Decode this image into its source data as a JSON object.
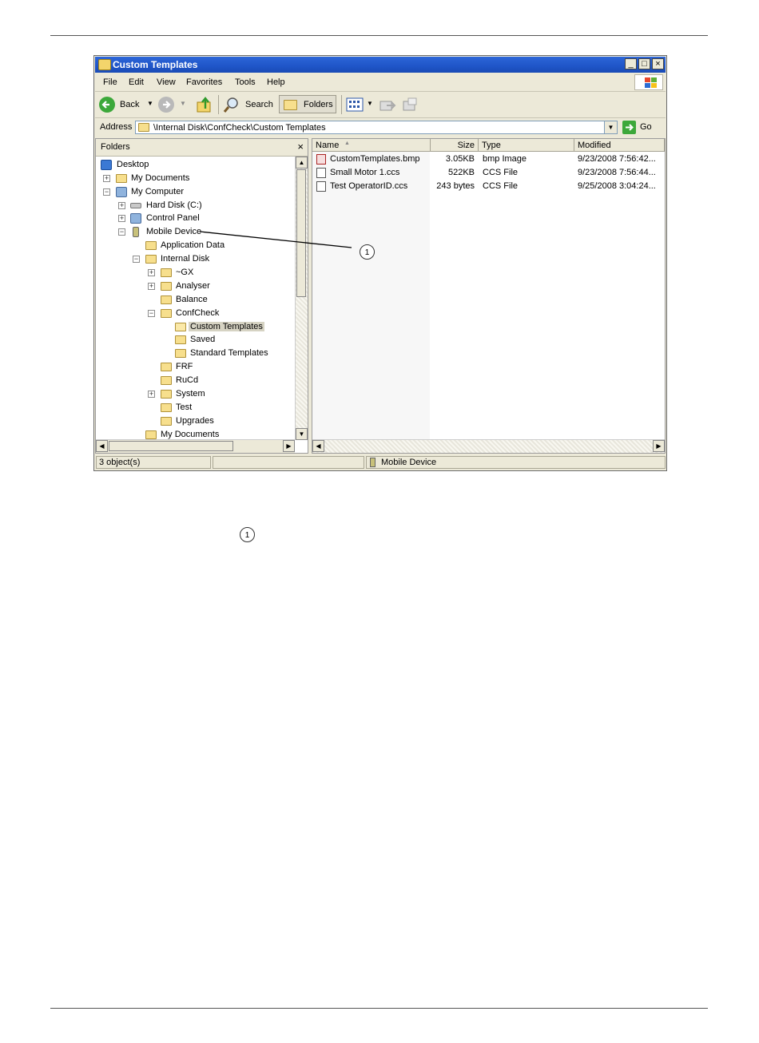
{
  "window": {
    "title": "Custom Templates",
    "minimize": "_",
    "maximize": "□",
    "close": "×"
  },
  "menu": [
    "File",
    "Edit",
    "View",
    "Favorites",
    "Tools",
    "Help"
  ],
  "toolbar": {
    "back_label": "Back",
    "search_label": "Search",
    "folders_label": "Folders"
  },
  "address": {
    "label": "Address",
    "value": "\\Internal Disk\\ConfCheck\\Custom Templates",
    "go_label": "Go"
  },
  "folders_pane": {
    "title": "Folders",
    "close": "×",
    "tree": [
      {
        "label": "Desktop",
        "expander": ""
      },
      {
        "label": "My Documents",
        "expander": "+"
      },
      {
        "label": "My Computer",
        "expander": "−"
      },
      {
        "label": "Hard Disk (C:)",
        "expander": "+"
      },
      {
        "label": "Control Panel",
        "expander": "+"
      },
      {
        "label": "Mobile Device",
        "expander": "−"
      },
      {
        "label": "Application Data",
        "expander": ""
      },
      {
        "label": "Internal Disk",
        "expander": "−"
      },
      {
        "label": "~GX",
        "expander": "+"
      },
      {
        "label": "Analyser",
        "expander": "+"
      },
      {
        "label": "Balance",
        "expander": ""
      },
      {
        "label": "ConfCheck",
        "expander": "−"
      },
      {
        "label": "Custom Templates",
        "expander": ""
      },
      {
        "label": "Saved",
        "expander": ""
      },
      {
        "label": "Standard Templates",
        "expander": ""
      },
      {
        "label": "FRF",
        "expander": ""
      },
      {
        "label": "RuCd",
        "expander": ""
      },
      {
        "label": "System",
        "expander": "+"
      },
      {
        "label": "Test",
        "expander": ""
      },
      {
        "label": "Upgrades",
        "expander": ""
      },
      {
        "label": "My Documents",
        "expander": ""
      }
    ]
  },
  "files": {
    "columns": [
      "Name",
      "Size",
      "Type",
      "Modified"
    ],
    "sort_indicator": "▲",
    "rows": [
      {
        "name": "CustomTemplates.bmp",
        "size": "3.05KB",
        "type": "bmp Image",
        "modified": "9/23/2008  7:56:42..."
      },
      {
        "name": "Small Motor 1.ccs",
        "size": "522KB",
        "type": "CCS File",
        "modified": "9/23/2008  7:56:44..."
      },
      {
        "name": "Test OperatorID.ccs",
        "size": "243 bytes",
        "type": "CCS File",
        "modified": "9/25/2008  3:04:24..."
      }
    ]
  },
  "status": {
    "objects": "3 object(s)",
    "location": "Mobile Device"
  },
  "callout": {
    "number": "1"
  }
}
